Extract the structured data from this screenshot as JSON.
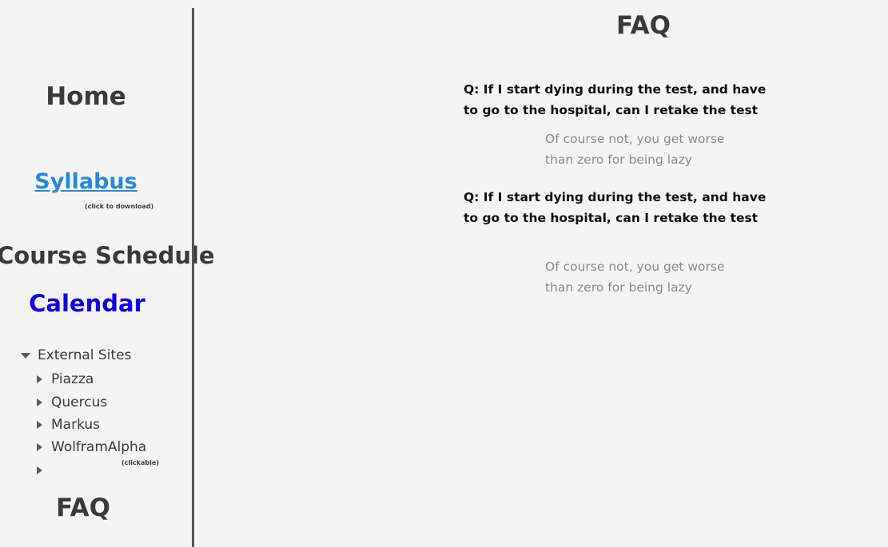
{
  "sidebar": {
    "home": "Home",
    "syllabus": "Syllabus",
    "syllabus_hint": "(click to download)",
    "course_schedule": "Course Schedule",
    "calendar": "Calendar",
    "external_sites": {
      "label": "External Sites",
      "items": [
        "Piazza",
        "Quercus",
        "Markus",
        "WolframAlpha",
        ""
      ],
      "clickable_hint": "(clickable)"
    },
    "faq": "FAQ"
  },
  "main": {
    "title": "FAQ",
    "faqs": [
      {
        "question": "Q: If I start dying during the test, and have to go to the hospital, can I retake the test",
        "answer": "Of course not, you get worse than zero for being lazy"
      },
      {
        "question": "Q: If I start dying during the test, and have to go to the hospital, can I retake the test",
        "answer": "Of course not, you get worse than zero for being lazy"
      }
    ]
  },
  "colors": {
    "background": "#f4f4f4",
    "text": "#3a3a3a",
    "syllabus_link": "#2a8ad6",
    "calendar_link": "#1400e6",
    "answer_text": "#8a8a8a"
  }
}
